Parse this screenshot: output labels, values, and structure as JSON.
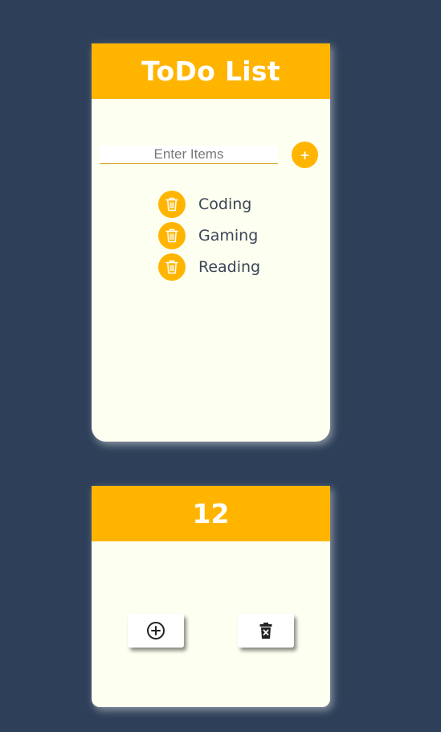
{
  "todo": {
    "title": "ToDo List",
    "input_placeholder": "Enter Items",
    "add_button_label": "+",
    "items": [
      {
        "label": "Coding"
      },
      {
        "label": "Gaming"
      },
      {
        "label": "Reading"
      }
    ]
  },
  "counter": {
    "value": "12",
    "increment_icon": "plus-circle-icon",
    "delete_icon": "trash-x-icon"
  },
  "colors": {
    "background": "#2e4059",
    "accent": "#ffb500",
    "card": "#fdfff0",
    "text": "#3a4657"
  },
  "icons": {
    "item_delete": "trash-icon"
  }
}
